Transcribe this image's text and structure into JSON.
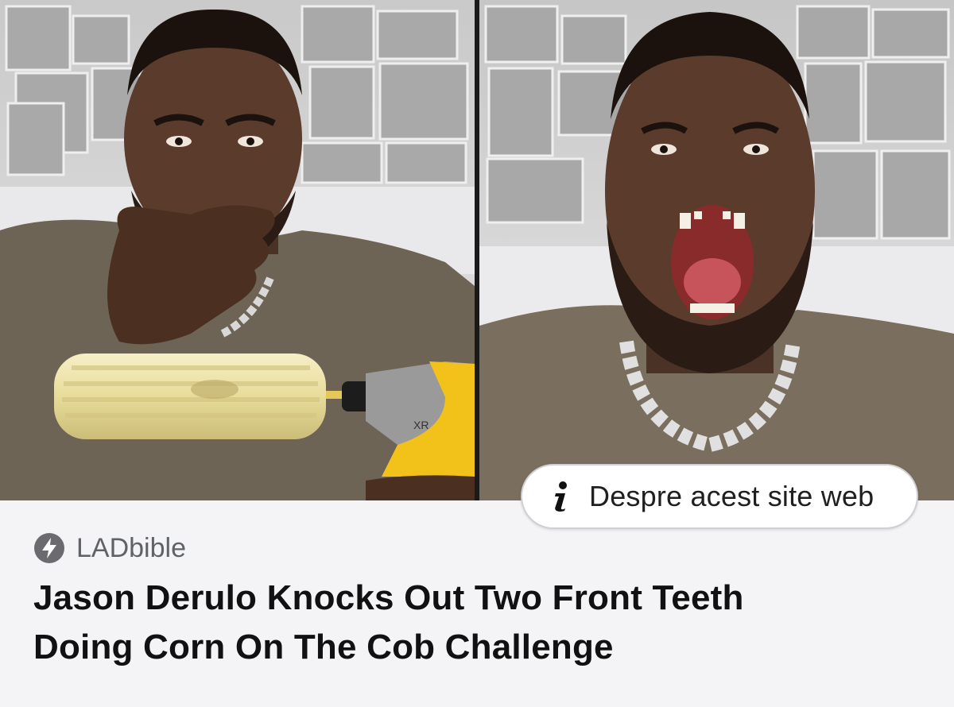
{
  "about_site": {
    "label": "Despre acest site web",
    "icon": "info-icon"
  },
  "source": {
    "name": "LADbible",
    "icon": "lightning-bolt-icon"
  },
  "headline": {
    "line1": "Jason Derulo Knocks Out Two Front Teeth",
    "line2": "Doing Corn On The Cob Challenge"
  },
  "image": {
    "left_panel": "man-holding-corn-on-drill-photo",
    "right_panel": "man-open-mouth-missing-teeth-photo"
  },
  "colors": {
    "card_background": "#f4f4f6",
    "headline_text": "#111111",
    "source_text": "#5f6368",
    "drill_yellow": "#f2c21b",
    "shirt": "#6e6455"
  }
}
